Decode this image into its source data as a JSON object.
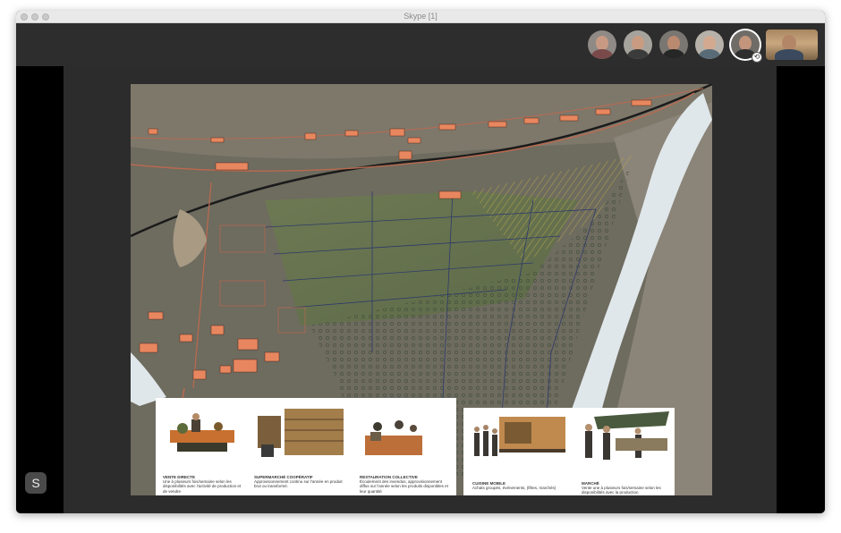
{
  "window": {
    "title": "Skype [1]"
  },
  "participants": [
    {
      "name": "participant-1",
      "skin": "#c89a83",
      "shirt": "#7a4a4a",
      "bg": "#8f8a86"
    },
    {
      "name": "participant-2",
      "skin": "#c99c82",
      "shirt": "#3b3b3b",
      "bg": "#a6a39c"
    },
    {
      "name": "participant-3",
      "skin": "#b98a70",
      "shirt": "#262626",
      "bg": "#7a7671"
    },
    {
      "name": "participant-4",
      "skin": "#d3aa8f",
      "shirt": "#5a6b78",
      "bg": "#b6b2aa"
    },
    {
      "name": "participant-5",
      "skin": "#c2957c",
      "shirt": "#2e2e2e",
      "bg": "#6f6b67"
    }
  ],
  "colors": {
    "window_bg": "#2b2b2b",
    "highlight_building": "#e8875f",
    "river": "#dfe7ea"
  },
  "slide": {
    "cards_left": [
      {
        "title": "VENTE DIRECTE",
        "text": "Une à plusieurs fois/semaine selon les disponibilités avec l'activité de production et de vendre"
      },
      {
        "title": "SUPERMARCHÉ COOPÉRATIF",
        "text": "Approvisionnement continu sur l'année en produit brut ou transformé."
      },
      {
        "title": "RESTAURATION COLLECTIVE",
        "text": "Écoulement des invendus, approvisionnement diffus sur l'année selon les produits disponibles et leur quantité"
      }
    ],
    "cards_right": [
      {
        "title": "CUISINE MOBILE",
        "text": "Achats groupés, événements, (fêtes, marchés)"
      },
      {
        "title": "MARCHÉ",
        "text": "Vente une à plusieurs fois/semaine selon les disponibilités avec la production"
      }
    ]
  },
  "skype_button": "S"
}
